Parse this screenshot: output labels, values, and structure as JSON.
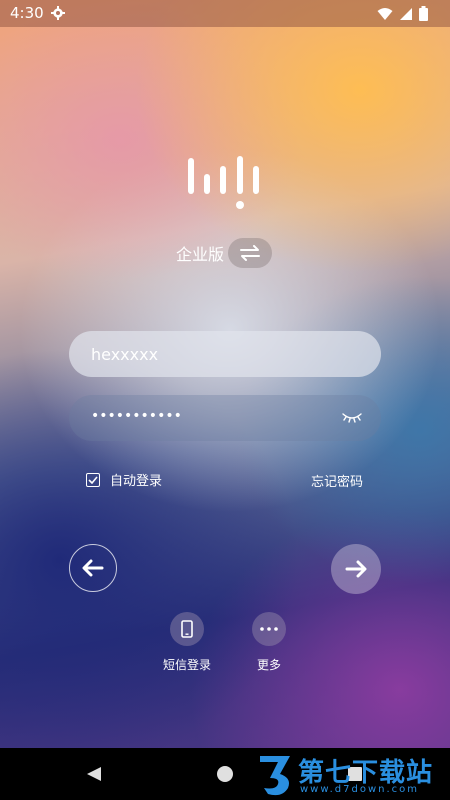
{
  "status_bar": {
    "time": "4:30",
    "icons": [
      "gear-icon",
      "wifi-icon",
      "signal-icon",
      "battery-icon"
    ]
  },
  "logo": {
    "icon": "sound-bars-logo-icon"
  },
  "edition": {
    "label": "企业版",
    "switch_icon": "swap-arrows-icon"
  },
  "login_form": {
    "username_value": "hexxxxx",
    "password_masked": "•••••••••••",
    "password_toggle_icon": "eye-closed-icon",
    "auto_login_label": "自动登录",
    "auto_login_checked": true,
    "forgot_password_label": "忘记密码"
  },
  "navigation": {
    "back_icon": "arrow-left-icon",
    "next_icon": "arrow-right-icon"
  },
  "alt_login": [
    {
      "label": "短信登录",
      "icon": "phone-icon"
    },
    {
      "label": "更多",
      "icon": "more-dots-icon"
    }
  ],
  "watermark": {
    "title": "第七下载站",
    "url": "www.d7down.com"
  },
  "colors": {
    "watermark_blue": "#2a8fe0",
    "text": "#ffffff"
  }
}
